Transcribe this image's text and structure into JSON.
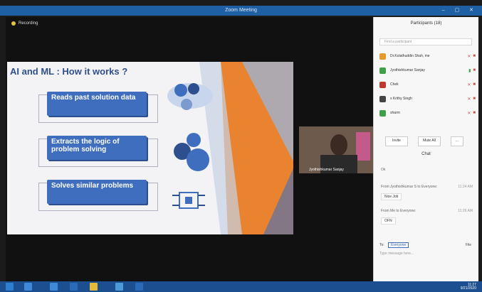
{
  "window": {
    "title": "Zoom Meeting",
    "controls": "– ▢ ✕"
  },
  "recording_label": "Recording",
  "slide": {
    "title": "AI and ML : How it works ?",
    "boxes": [
      "Reads past solution data",
      "Extracts the logic of problem solving",
      "Solves similar problems"
    ]
  },
  "webcam": {
    "name": "Jyothishkumar Sanjay"
  },
  "participants_panel": {
    "title": "Participants (18)",
    "search_placeholder": "Find a participant",
    "participants": [
      {
        "name": "Dr.Kolathuddin Shah, me",
        "color": "#e69a2c"
      },
      {
        "name": "Jyothishkumar Sanjay",
        "color": "#3fa04a"
      },
      {
        "name": "Chek",
        "color": "#c0392b"
      },
      {
        "name": "s Krithy Singh",
        "color": "#444444"
      },
      {
        "name": "sharm",
        "color": "#3fa04a"
      }
    ],
    "invite_label": "Invite",
    "mute_all_label": "Mute All",
    "more_label": "..."
  },
  "chat": {
    "title": "Chat",
    "messages": [
      {
        "sender": "Ok",
        "time": ""
      },
      {
        "sender": "From Jyothishkumar S to Everyone:",
        "time": "11:24 AM",
        "text": "Nice Job"
      },
      {
        "sender": "From Me to Everyone:",
        "time": "11:26 AM",
        "text": "OFN"
      }
    ],
    "to_label": "To:",
    "to_value": "Everyone",
    "file_label": "File",
    "input_placeholder": "Type message here..."
  },
  "taskbar": {
    "time": "11:27",
    "date": "9/21/2020"
  },
  "colors": {
    "accent": "#1f5fa3",
    "slide_box": "#3f6ebf",
    "orange": "#e9832f"
  }
}
